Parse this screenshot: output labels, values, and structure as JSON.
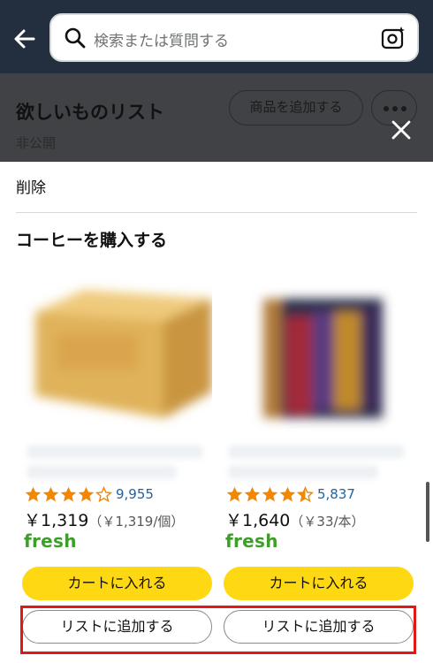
{
  "search": {
    "placeholder": "検索または質問する"
  },
  "wishlist": {
    "title": "欲しいものリスト",
    "privacy": "非公開",
    "add_item_label": "商品を追加する"
  },
  "sheet": {
    "delete_label": "削除",
    "section_title": "コーヒーを購入する"
  },
  "products": [
    {
      "rating": 4.0,
      "review_count": "9,955",
      "price": "￥1,319",
      "unit_price": "（￥1,319/個）",
      "badge": "fresh",
      "cart_label": "カートに入れる",
      "list_label": "リストに追加する"
    },
    {
      "rating": 4.5,
      "review_count": "5,837",
      "price": "￥1,640",
      "unit_price": "（￥33/本）",
      "badge": "fresh",
      "cart_label": "カートに入れる",
      "list_label": "リストに追加する"
    }
  ],
  "colors": {
    "header_bg": "#232f3e",
    "cart_button": "#ffd814",
    "star": "#f08804",
    "link": "#2162a1",
    "fresh": "#3d9e2a",
    "highlight": "#e01818"
  }
}
